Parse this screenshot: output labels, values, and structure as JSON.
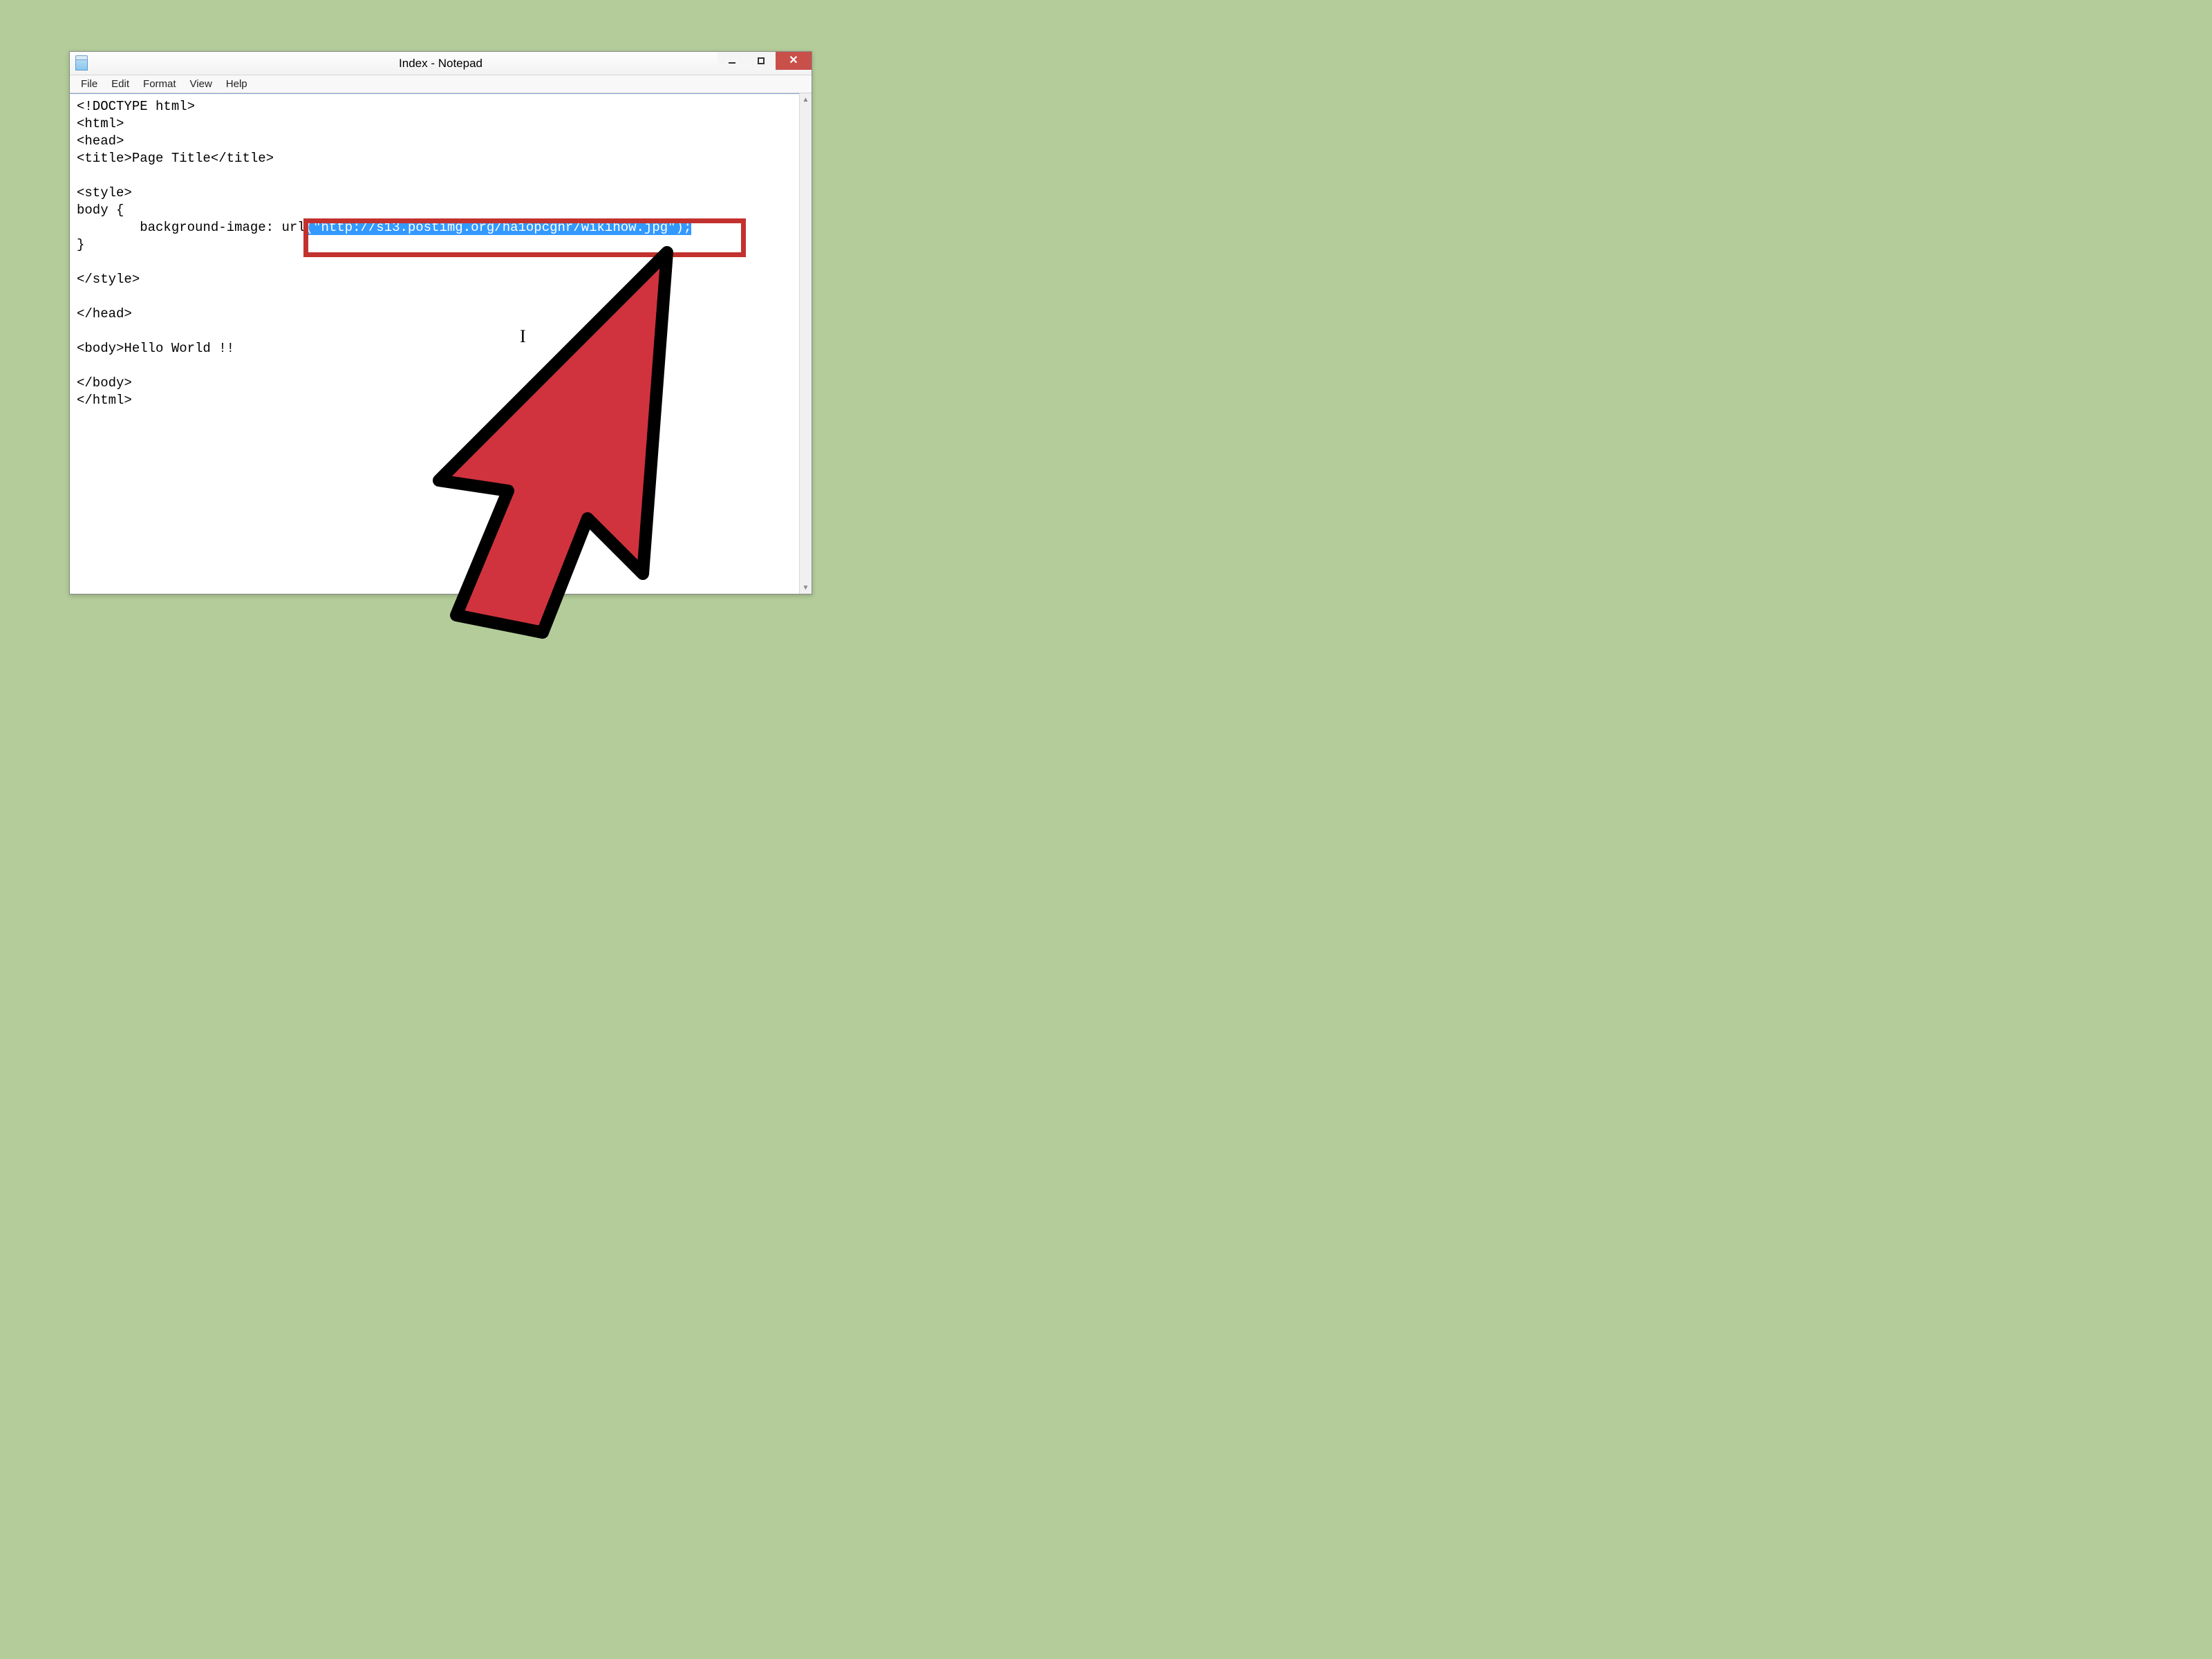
{
  "window": {
    "title": "Index - Notepad"
  },
  "menu": {
    "file": "File",
    "edit": "Edit",
    "format": "Format",
    "view": "View",
    "help": "Help"
  },
  "editor": {
    "line1": "<!DOCTYPE html>",
    "line2": "<html>",
    "line3": "<head>",
    "line4": "<title>Page Title</title>",
    "line5": "",
    "line6": "<style>",
    "line7": "body {",
    "line8_prefix": "        background-image: url",
    "line8_selected": "(\"http://s13.postimg.org/ha1opcgnr/wikihow.jpg\");",
    "line9": "}",
    "line10": "",
    "line11": "</style>",
    "line12": "",
    "line13": "</head>",
    "line14": "",
    "line15": "<body>Hello World !!",
    "line16": "",
    "line17": "</body>",
    "line18": "</html>"
  },
  "annotation": {
    "highlight_color": "#c3312e",
    "selection_bg": "#3399ff",
    "arrow_fill": "#d0333e"
  }
}
